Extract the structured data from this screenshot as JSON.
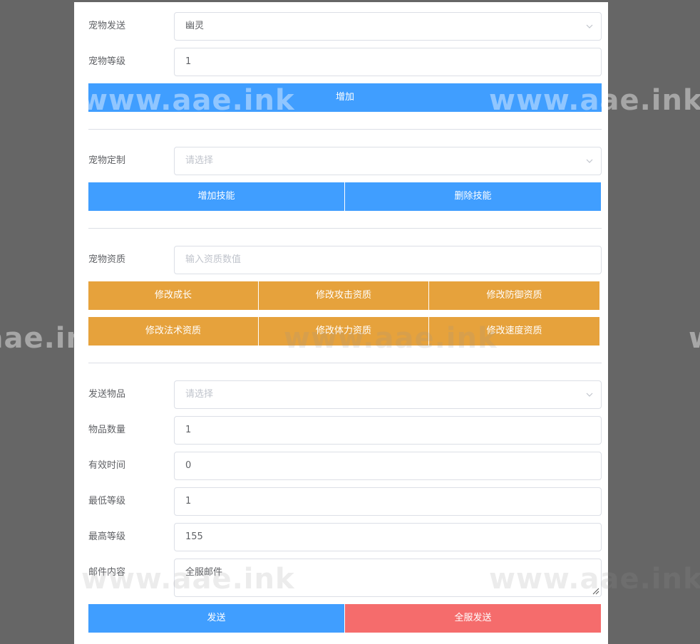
{
  "form": {
    "pet_send": {
      "label": "宠物发送",
      "value": "幽灵"
    },
    "pet_level": {
      "label": "宠物等级",
      "value": "1"
    },
    "add_button": "增加",
    "pet_custom": {
      "label": "宠物定制",
      "placeholder": "请选择"
    },
    "add_skill_button": "增加技能",
    "delete_skill_button": "删除技能",
    "pet_aptitude": {
      "label": "宠物资质",
      "placeholder": "输入资质数值"
    },
    "aptitude_buttons": [
      "修改成长",
      "修改攻击资质",
      "修改防御资质",
      "修改法术资质",
      "修改体力资质",
      "修改速度资质"
    ],
    "send_item": {
      "label": "发送物品",
      "placeholder": "请选择"
    },
    "item_count": {
      "label": "物品数量",
      "value": "1"
    },
    "valid_time": {
      "label": "有效时间",
      "value": "0"
    },
    "min_level": {
      "label": "最低等级",
      "value": "1"
    },
    "max_level": {
      "label": "最高等级",
      "value": "155"
    },
    "mail_content": {
      "label": "邮件内容",
      "value": "全服邮件"
    },
    "send_button": "发送",
    "send_all_button": "全服发送"
  },
  "watermark": {
    "text": "www.aae.ink"
  },
  "colors": {
    "primary": "#409eff",
    "warning": "#e6a23c",
    "danger": "#f56c6c",
    "overlay": "#666666"
  },
  "icons": {
    "select_arrow": "chevron-down-icon",
    "resize": "resize-handle-icon"
  }
}
